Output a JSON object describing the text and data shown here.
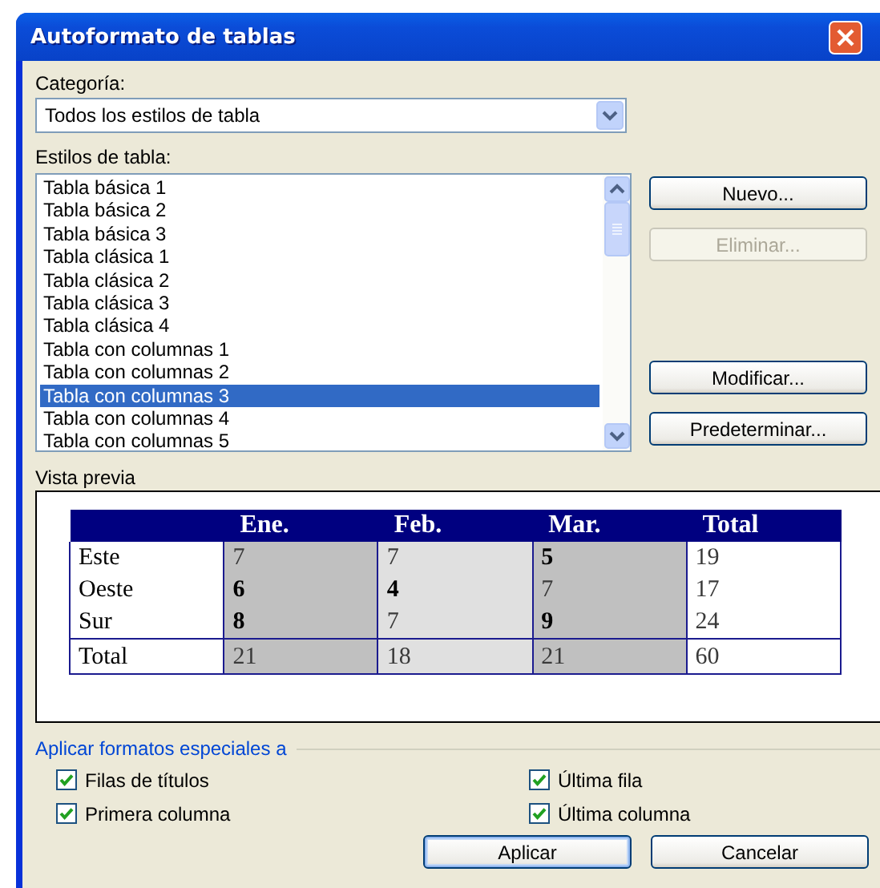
{
  "window": {
    "title": "Autoformato de tablas"
  },
  "category": {
    "label": "Categoría:",
    "value": "Todos los estilos de tabla"
  },
  "styles": {
    "label": "Estilos de tabla:",
    "items": [
      {
        "label": "Tabla básica 1",
        "selected": false
      },
      {
        "label": "Tabla básica 2",
        "selected": false
      },
      {
        "label": "Tabla básica 3",
        "selected": false
      },
      {
        "label": "Tabla clásica 1",
        "selected": false
      },
      {
        "label": "Tabla clásica 2",
        "selected": false
      },
      {
        "label": "Tabla clásica 3",
        "selected": false
      },
      {
        "label": "Tabla clásica 4",
        "selected": false
      },
      {
        "label": "Tabla con columnas 1",
        "selected": false
      },
      {
        "label": "Tabla con columnas 2",
        "selected": false
      },
      {
        "label": "Tabla con columnas 3",
        "selected": true
      },
      {
        "label": "Tabla con columnas 4",
        "selected": false
      },
      {
        "label": "Tabla con columnas 5",
        "selected": false
      }
    ]
  },
  "side_buttons": [
    {
      "label": "Nuevo...",
      "disabled": false
    },
    {
      "label": "Eliminar...",
      "disabled": true
    },
    {
      "label": "Modificar...",
      "disabled": false
    },
    {
      "label": "Predeterminar...",
      "disabled": false
    }
  ],
  "preview": {
    "label": "Vista previa",
    "columns": [
      "Ene.",
      "Feb.",
      "Mar.",
      "Total"
    ],
    "rows": [
      {
        "label": "Este",
        "cells": [
          {
            "text": "7",
            "bold": false
          },
          {
            "text": "7",
            "bold": false
          },
          {
            "text": "5",
            "bold": true
          },
          {
            "text": "19",
            "bold": false
          }
        ]
      },
      {
        "label": "Oeste",
        "cells": [
          {
            "text": "6",
            "bold": true
          },
          {
            "text": "4",
            "bold": true
          },
          {
            "text": "7",
            "bold": false
          },
          {
            "text": "17",
            "bold": false
          }
        ]
      },
      {
        "label": "Sur",
        "cells": [
          {
            "text": "8",
            "bold": true
          },
          {
            "text": "7",
            "bold": false
          },
          {
            "text": "9",
            "bold": true
          },
          {
            "text": "24",
            "bold": false
          }
        ]
      }
    ],
    "total_row": {
      "label": "Total",
      "cells": [
        {
          "text": "21",
          "bold": false
        },
        {
          "text": "18",
          "bold": false
        },
        {
          "text": "21",
          "bold": false
        },
        {
          "text": "60",
          "bold": false
        }
      ]
    }
  },
  "special": {
    "label": "Aplicar formatos especiales a",
    "options": [
      {
        "label": "Filas de títulos",
        "checked": true
      },
      {
        "label": "Última fila",
        "checked": true
      },
      {
        "label": "Primera columna",
        "checked": true
      },
      {
        "label": "Última columna",
        "checked": true
      }
    ]
  },
  "buttons": [
    {
      "label": "Aplicar",
      "default": true
    },
    {
      "label": "Cancelar",
      "default": false
    }
  ]
}
